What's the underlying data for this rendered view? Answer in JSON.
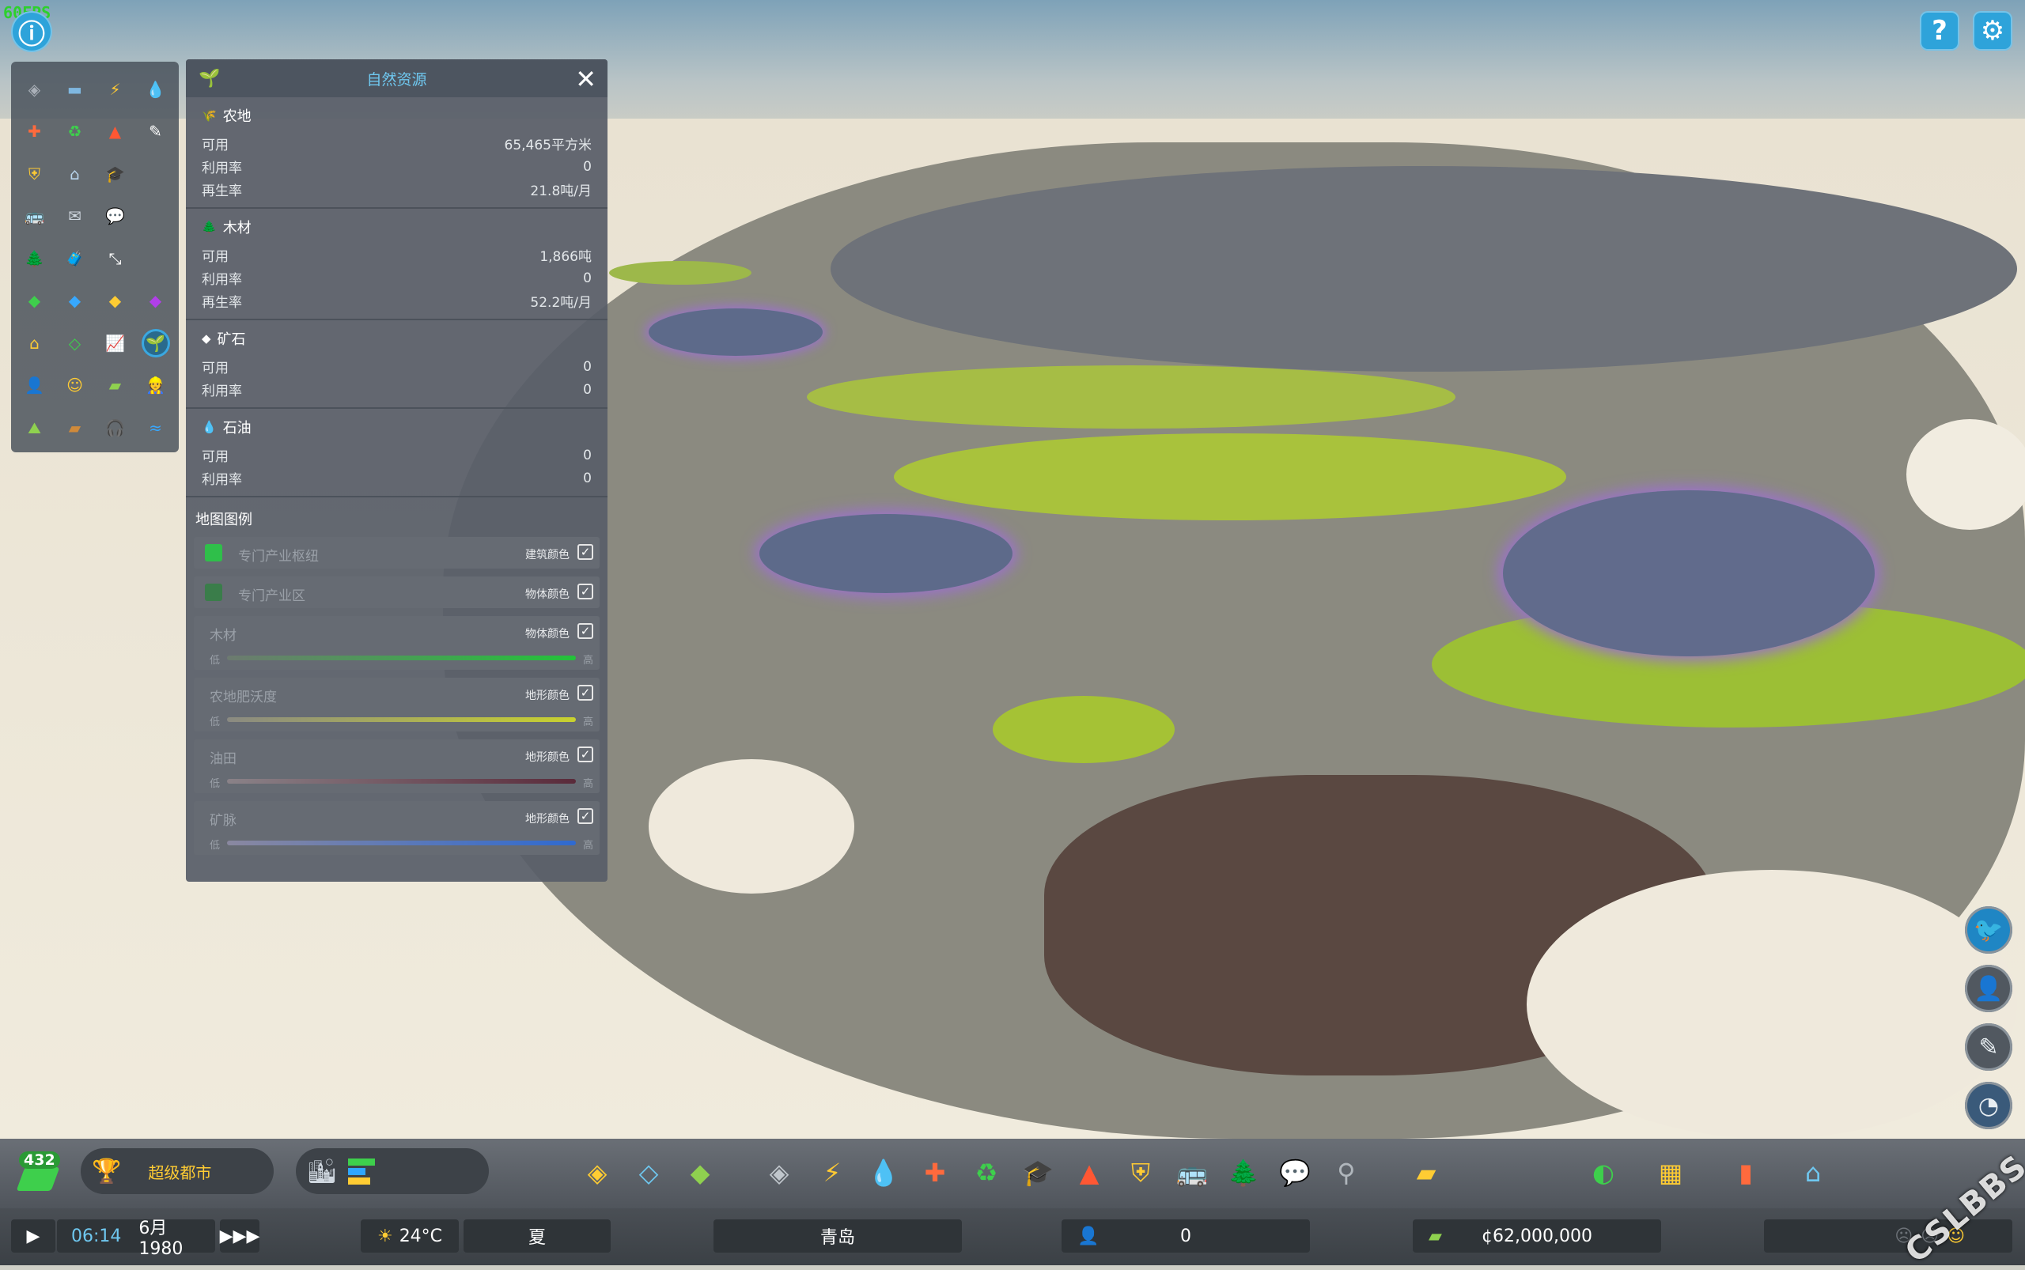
{
  "hud": {
    "fps": "60FPS"
  },
  "info_grid": [
    {
      "icon": "road-icon",
      "glyph": "◈",
      "color": "#aab0b8"
    },
    {
      "icon": "traffic-icon",
      "glyph": "▬",
      "color": "#7fb7e0"
    },
    {
      "icon": "electricity-icon",
      "glyph": "⚡",
      "color": "#ffc933"
    },
    {
      "icon": "water-icon",
      "glyph": "💧",
      "color": "#37a8ff"
    },
    {
      "icon": "health-icon",
      "glyph": "✚",
      "color": "#ff6a3d"
    },
    {
      "icon": "garbage-icon",
      "glyph": "♻",
      "color": "#3ecf4c"
    },
    {
      "icon": "fire-icon",
      "glyph": "▲",
      "color": "#ff5733"
    },
    {
      "icon": "maintenance-icon",
      "glyph": "✎",
      "color": "#ffffff"
    },
    {
      "icon": "police-icon",
      "glyph": "⛨",
      "color": "#ffcc33"
    },
    {
      "icon": "landmark-icon",
      "glyph": "⌂",
      "color": "#b9d6ee"
    },
    {
      "icon": "education-icon",
      "glyph": "🎓",
      "color": "#9fb9d0"
    },
    {
      "icon": "blank-cell",
      "glyph": "",
      "color": "#fff"
    },
    {
      "icon": "public-transport-icon",
      "glyph": "🚌",
      "color": "#3ecf4c"
    },
    {
      "icon": "mail-icon",
      "glyph": "✉",
      "color": "#d0d8e0"
    },
    {
      "icon": "chat-icon",
      "glyph": "💬",
      "color": "#ffffff"
    },
    {
      "icon": "blank-cell",
      "glyph": "",
      "color": "#fff"
    },
    {
      "icon": "park-icon",
      "glyph": "🌲",
      "color": "#3ecf4c"
    },
    {
      "icon": "tourism-icon",
      "glyph": "🧳",
      "color": "#37a8ff"
    },
    {
      "icon": "outside-connection-icon",
      "glyph": "⤡",
      "color": "#ffffff"
    },
    {
      "icon": "blank-cell",
      "glyph": "",
      "color": "#fff"
    },
    {
      "icon": "residential-zone-icon",
      "glyph": "◆",
      "color": "#3ecf4c"
    },
    {
      "icon": "commercial-zone-icon",
      "glyph": "◆",
      "color": "#37a8ff"
    },
    {
      "icon": "industrial-zone-icon",
      "glyph": "◆",
      "color": "#ffcc33"
    },
    {
      "icon": "office-zone-icon",
      "glyph": "◆",
      "color": "#b13fe8"
    },
    {
      "icon": "housing-icon",
      "glyph": "⌂",
      "color": "#ffcc33"
    },
    {
      "icon": "land-value-icon",
      "glyph": "◇",
      "color": "#3ecf4c"
    },
    {
      "icon": "statistics-icon",
      "glyph": "📈",
      "color": "#ff5f5f"
    },
    {
      "icon": "natural-resources-icon",
      "glyph": "🌱",
      "color": "#8fd14f",
      "active": true
    },
    {
      "icon": "citizen-icon",
      "glyph": "👤",
      "color": "#b9d6ee"
    },
    {
      "icon": "happiness-icon",
      "glyph": "☺",
      "color": "#ffcc33"
    },
    {
      "icon": "money-icon",
      "glyph": "▰",
      "color": "#8fd14f"
    },
    {
      "icon": "employment-icon",
      "glyph": "👷",
      "color": "#ffcc33"
    },
    {
      "icon": "terrain-icon",
      "glyph": "⛰",
      "color": "#8fd14f"
    },
    {
      "icon": "pollution-icon",
      "glyph": "▰",
      "color": "#d08a3a"
    },
    {
      "icon": "noise-icon",
      "glyph": "🎧",
      "color": "#ffcc33"
    },
    {
      "icon": "water-table-icon",
      "glyph": "≈",
      "color": "#37a8ff"
    }
  ],
  "panel": {
    "title": "自然资源",
    "sections": [
      {
        "name": "农地",
        "icon_glyph": "🌾",
        "rows": [
          {
            "label": "可用",
            "value": "65,465平方米"
          },
          {
            "label": "利用率",
            "value": "0"
          },
          {
            "label": "再生率",
            "value": "21.8吨/月"
          }
        ]
      },
      {
        "name": "木材",
        "icon_glyph": "🌲",
        "rows": [
          {
            "label": "可用",
            "value": "1,866吨"
          },
          {
            "label": "利用率",
            "value": "0"
          },
          {
            "label": "再生率",
            "value": "52.2吨/月"
          }
        ]
      },
      {
        "name": "矿石",
        "icon_glyph": "◆",
        "rows": [
          {
            "label": "可用",
            "value": "0"
          },
          {
            "label": "利用率",
            "value": "0"
          }
        ]
      },
      {
        "name": "石油",
        "icon_glyph": "💧",
        "rows": [
          {
            "label": "可用",
            "value": "0"
          },
          {
            "label": "利用率",
            "value": "0"
          }
        ]
      }
    ],
    "legend_title": "地图图例",
    "legend": [
      {
        "name": "专门产业枢纽",
        "mode": "建筑颜色",
        "swatch": "#2fbf4a",
        "checked": true
      },
      {
        "name": "专门产业区",
        "mode": "物体颜色",
        "swatch": "#3a7d4a",
        "checked": true
      },
      {
        "name": "木材",
        "mode": "物体颜色",
        "low": "低",
        "high": "高",
        "gradient": [
          "#6d7a70",
          "#23c23a"
        ],
        "checked": true
      },
      {
        "name": "农地肥沃度",
        "mode": "地形颜色",
        "low": "低",
        "high": "高",
        "gradient": [
          "#8a8a82",
          "#c9d22e"
        ],
        "checked": true
      },
      {
        "name": "油田",
        "mode": "地形颜色",
        "low": "低",
        "high": "高",
        "gradient": [
          "#8a8288",
          "#5a2a3a"
        ],
        "checked": true
      },
      {
        "name": "矿脉",
        "mode": "地形颜色",
        "low": "低",
        "high": "高",
        "gradient": [
          "#8a88a0",
          "#2f6ad0"
        ],
        "checked": true
      }
    ]
  },
  "toolbar": {
    "milestone_count": "432",
    "milestone_label": "超级都市",
    "tools": [
      {
        "icon": "zoning-icon",
        "glyph": "◈",
        "color": "#ffcc33"
      },
      {
        "icon": "district-icon",
        "glyph": "◇",
        "color": "#6fc8f0"
      },
      {
        "icon": "land-value-tool-icon",
        "glyph": "◆",
        "color": "#8fd14f"
      },
      {
        "icon": "roads-icon",
        "glyph": "◈",
        "color": "#c0c6cc"
      },
      {
        "icon": "electricity-tool-icon",
        "glyph": "⚡",
        "color": "#ffc933"
      },
      {
        "icon": "water-tool-icon",
        "glyph": "💧",
        "color": "#37a8ff"
      },
      {
        "icon": "healthcare-tool-icon",
        "glyph": "✚",
        "color": "#ff6a3d"
      },
      {
        "icon": "garbage-tool-icon",
        "glyph": "♻",
        "color": "#3ecf4c"
      },
      {
        "icon": "education-tool-icon",
        "glyph": "🎓",
        "color": "#9fb9d0"
      },
      {
        "icon": "fire-tool-icon",
        "glyph": "▲",
        "color": "#ff5733"
      },
      {
        "icon": "police-tool-icon",
        "glyph": "⛨",
        "color": "#ffcc33"
      },
      {
        "icon": "transport-tool-icon",
        "glyph": "🚌",
        "color": "#3ecf4c"
      },
      {
        "icon": "parks-tool-icon",
        "glyph": "🌲",
        "color": "#3ecf4c"
      },
      {
        "icon": "chirper-tool-icon",
        "glyph": "💬",
        "color": "#ffffff"
      },
      {
        "icon": "landscaping-tool-icon",
        "glyph": "⚲",
        "color": "#b0b6bc"
      },
      {
        "icon": "bulldozer-icon",
        "glyph": "▰",
        "color": "#ffcc33"
      },
      {
        "icon": "policies-icon",
        "glyph": "◐",
        "color": "#3ecf4c"
      },
      {
        "icon": "map-icon",
        "glyph": "▦",
        "color": "#ffcc33"
      },
      {
        "icon": "economy-icon",
        "glyph": "▮",
        "color": "#ff6a3d"
      },
      {
        "icon": "unique-buildings-icon",
        "glyph": "⌂",
        "color": "#6fc8f0"
      }
    ]
  },
  "status": {
    "time": "06:14",
    "date": "6月 1980",
    "temperature": "24°C",
    "season": "夏",
    "city_name": "青岛",
    "population": "0",
    "money": "¢62,000,000"
  },
  "watermark": "CSLBBS.NET"
}
